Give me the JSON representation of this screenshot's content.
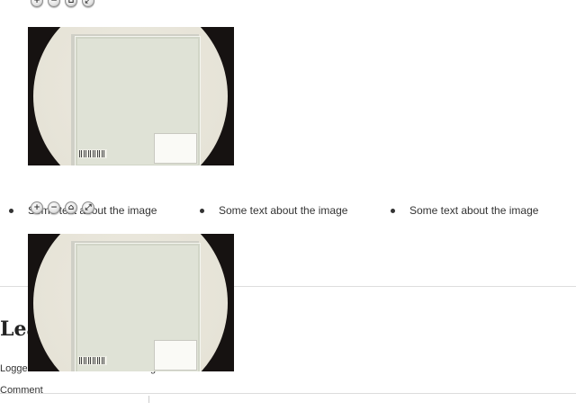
{
  "gallery": {
    "zoom_controls": [
      {
        "icon": "zoom-in-icon",
        "glyph": "+"
      },
      {
        "icon": "zoom-out-icon",
        "glyph": "−"
      },
      {
        "icon": "home-icon",
        "glyph": "⌂"
      },
      {
        "icon": "fullscreen-icon",
        "glyph": "⤢"
      }
    ],
    "captions": [
      "Some text about the image",
      "Some text about the image",
      "Some text about the image"
    ]
  },
  "comments": {
    "heading": "Lea",
    "logged_in_text": "Logged in as Haseeb Rahman. Log out?",
    "comment_label": "Comment"
  },
  "colors": {
    "text": "#333333",
    "divider": "#dddddd",
    "viewer_bg": "#161211"
  }
}
